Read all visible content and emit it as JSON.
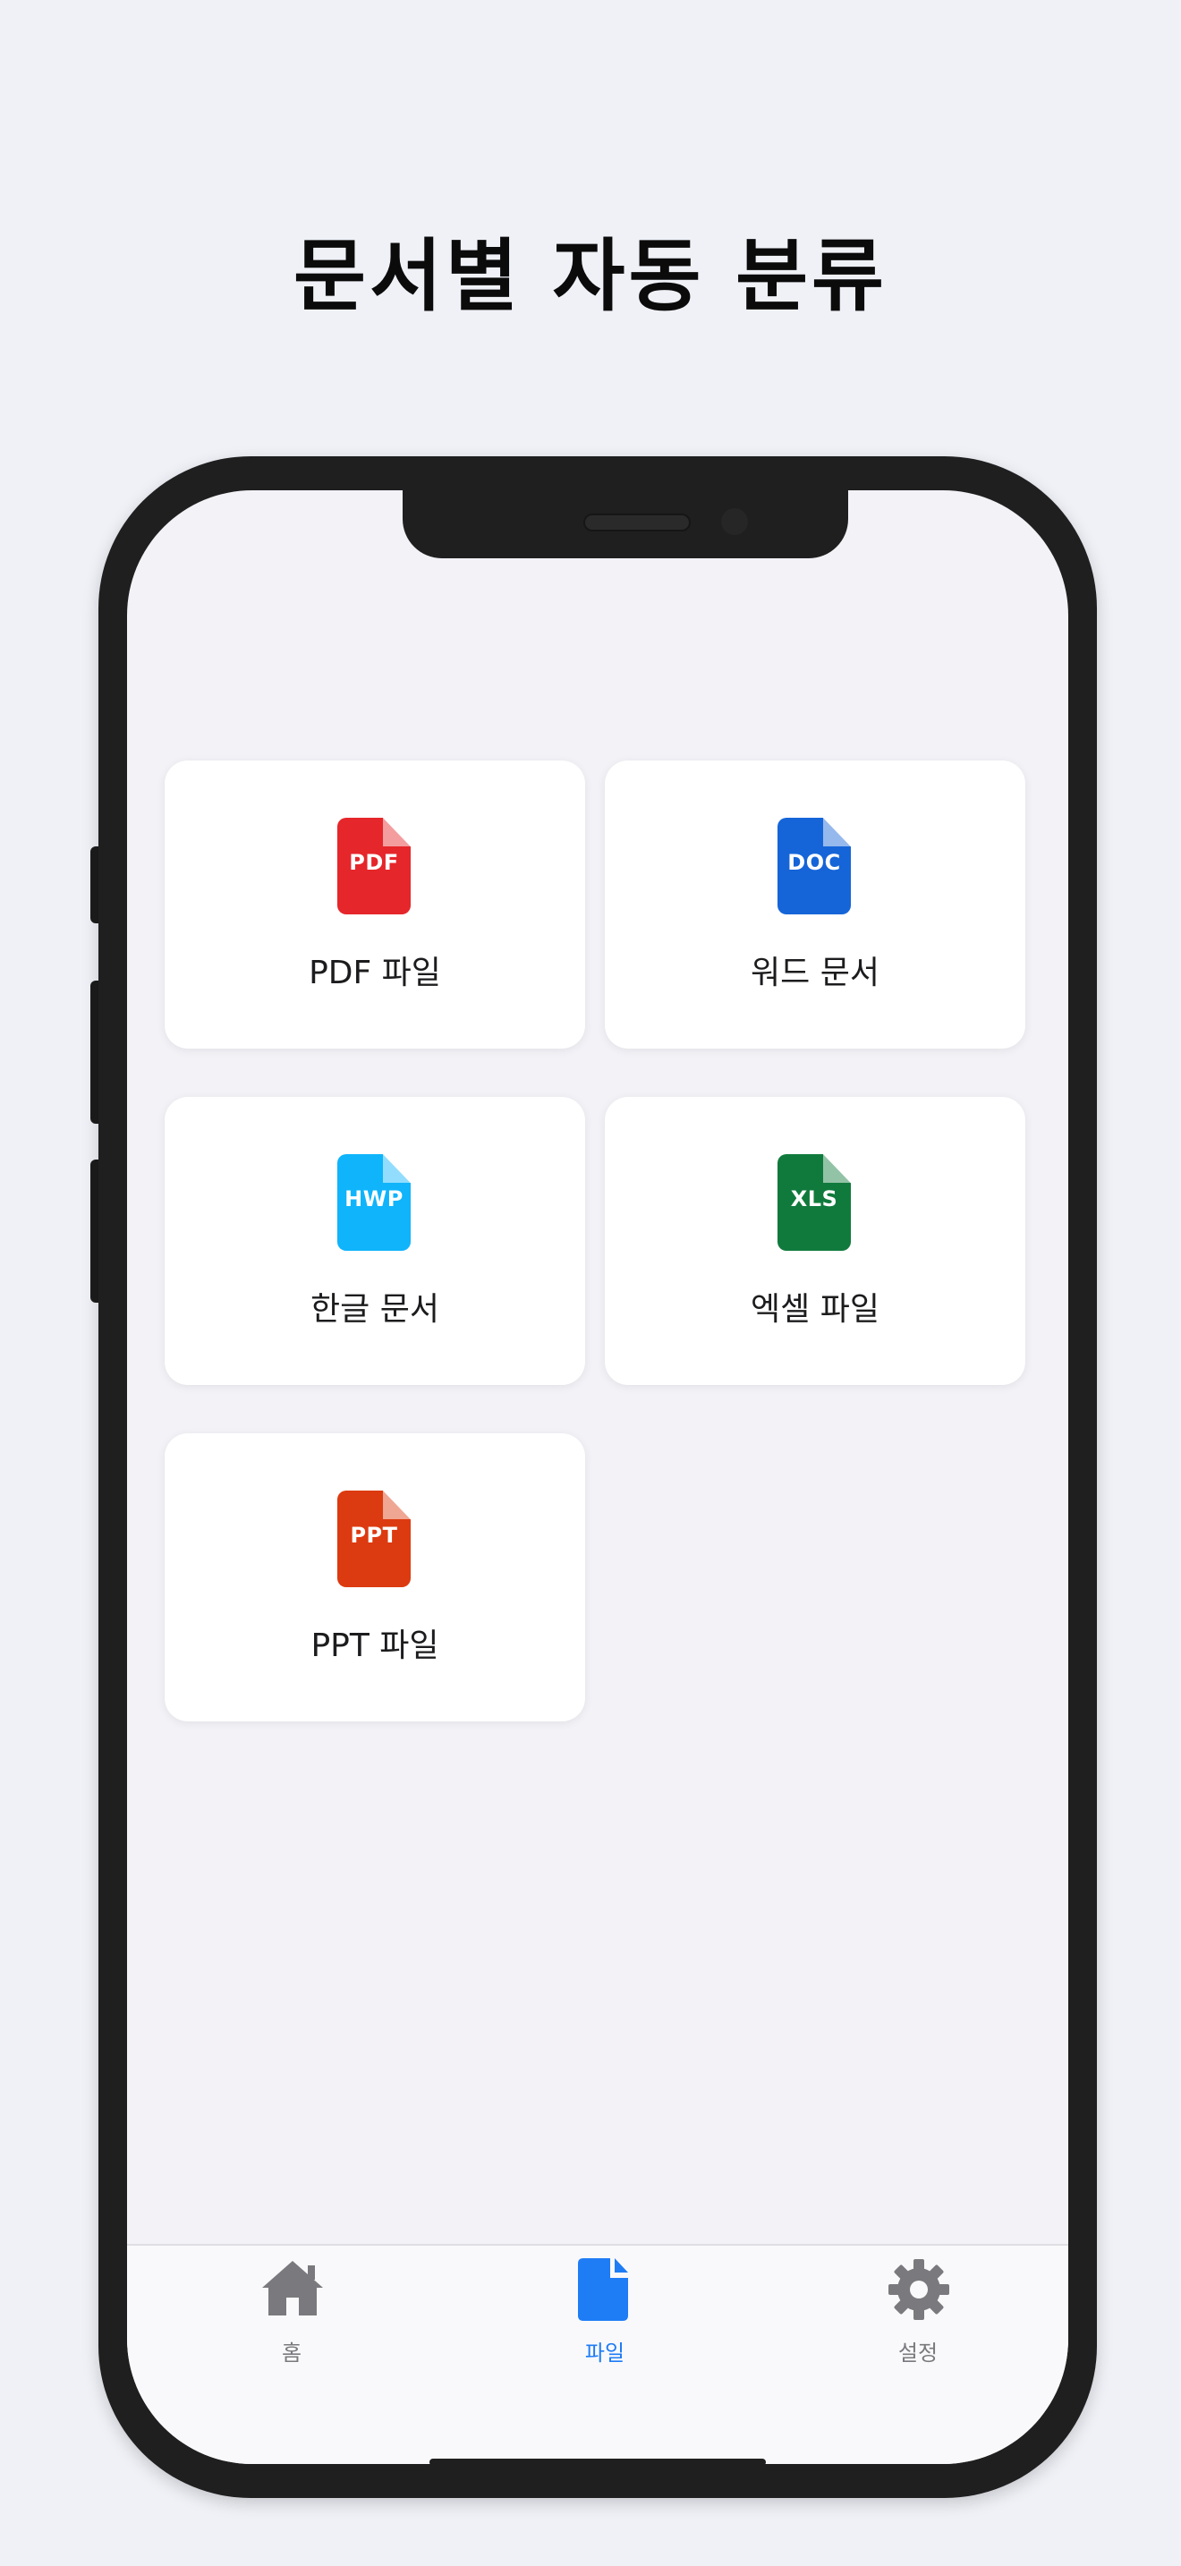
{
  "headline": "문서별 자동 분류",
  "categories": [
    {
      "label": "PDF 파일",
      "icon_text": "PDF",
      "icon_name": "pdf-file-icon",
      "color": "#e5262b"
    },
    {
      "label": "워드 문서",
      "icon_text": "DOC",
      "icon_name": "doc-file-icon",
      "color": "#1565d8"
    },
    {
      "label": "한글 문서",
      "icon_text": "HWP",
      "icon_name": "hwp-file-icon",
      "color": "#0fb4fb"
    },
    {
      "label": "엑셀 파일",
      "icon_text": "XLS",
      "icon_name": "xls-file-icon",
      "color": "#107a3c"
    },
    {
      "label": "PPT 파일",
      "icon_text": "PPT",
      "icon_name": "ppt-file-icon",
      "color": "#dc3a10"
    }
  ],
  "tabbar": {
    "tabs": [
      {
        "label": "홈",
        "icon": "home-icon",
        "active": false
      },
      {
        "label": "파일",
        "icon": "file-icon",
        "active": true
      },
      {
        "label": "설정",
        "icon": "gear-icon",
        "active": false
      }
    ],
    "active_color": "#1e7cf5",
    "inactive_color": "#7a7a7e"
  }
}
